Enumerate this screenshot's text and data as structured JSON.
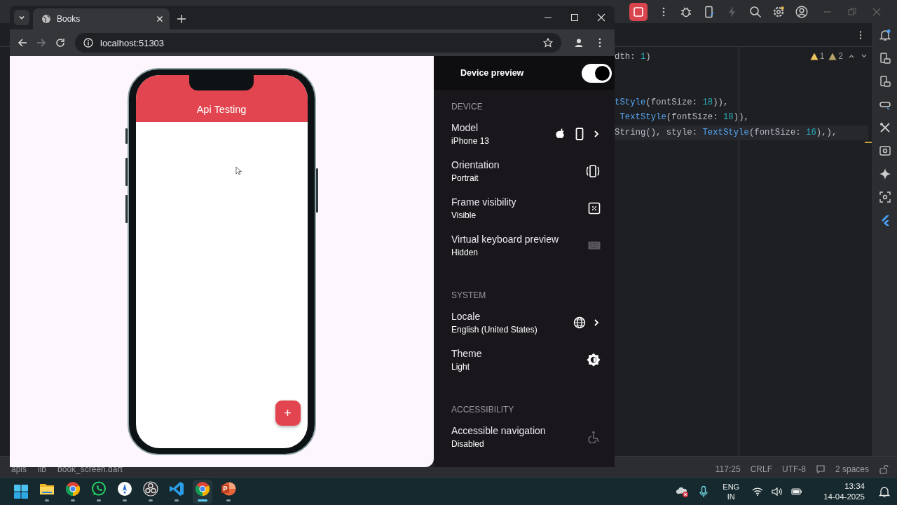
{
  "ide": {
    "inspections": [
      {
        "count": "1",
        "kind": "warning"
      },
      {
        "count": "2",
        "kind": "weak"
      }
    ],
    "code_lines": [
      {
        "current": false,
        "tokens": [
          {
            "text": "dth: ",
            "kind": "plain"
          },
          {
            "text": "1",
            "kind": "number"
          },
          {
            "text": ")",
            "kind": "plain"
          }
        ]
      },
      {
        "current": false,
        "tokens": [
          {
            "text": "tStyle",
            "kind": "class"
          },
          {
            "text": "(fontSize: ",
            "kind": "plain"
          },
          {
            "text": "18",
            "kind": "number"
          },
          {
            "text": ")),",
            "kind": "plain"
          }
        ]
      },
      {
        "current": false,
        "tokens": [
          {
            "text": " TextStyle",
            "kind": "class"
          },
          {
            "text": "(fontSize: ",
            "kind": "plain"
          },
          {
            "text": "18",
            "kind": "number"
          },
          {
            "text": ")),",
            "kind": "plain"
          }
        ]
      },
      {
        "current": true,
        "tokens": [
          {
            "text": "String(), style: ",
            "kind": "plain"
          },
          {
            "text": "TextStyle",
            "kind": "class"
          },
          {
            "text": "(fontSize: ",
            "kind": "plain"
          },
          {
            "text": "16",
            "kind": "number"
          },
          {
            "text": "),),",
            "kind": "plain"
          }
        ]
      }
    ],
    "breadcrumb": [
      "apis",
      "lib",
      "book_screen.dart"
    ],
    "status_bar": {
      "position": "117:25",
      "line_separator": "CRLF",
      "encoding": "UTF-8",
      "indent": "2 spaces"
    }
  },
  "browser": {
    "tabs": [
      {
        "title": "Books",
        "selected": true
      }
    ],
    "address": "localhost:51303",
    "forward_disabled": true
  },
  "app": {
    "title": "Api Testing",
    "fab": "+"
  },
  "device_preview": {
    "title": "Device preview",
    "on": true,
    "sections": [
      {
        "heading": "DEVICE",
        "rows": [
          {
            "kind": "model",
            "label": "Model",
            "value": "iPhone 13"
          },
          {
            "kind": "orientation",
            "label": "Orientation",
            "value": "Portrait"
          },
          {
            "kind": "frame",
            "label": "Frame visibility",
            "value": "Visible"
          },
          {
            "kind": "keyboard",
            "label": "Virtual keyboard preview",
            "value": "Hidden"
          }
        ]
      },
      {
        "heading": "SYSTEM",
        "rows": [
          {
            "kind": "locale",
            "label": "Locale",
            "value": "English (United States)"
          },
          {
            "kind": "theme",
            "label": "Theme",
            "value": "Light"
          }
        ]
      },
      {
        "heading": "ACCESSIBILITY",
        "rows": [
          {
            "kind": "accessibility",
            "label": "Accessible navigation",
            "value": "Disabled"
          }
        ]
      }
    ]
  },
  "taskbar": {
    "apps": [
      {
        "kind": "start",
        "running": false,
        "selected": false
      },
      {
        "kind": "files",
        "running": true,
        "selected": false
      },
      {
        "kind": "chrome",
        "running": true,
        "selected": false
      },
      {
        "kind": "whatsapp",
        "running": true,
        "selected": false
      },
      {
        "kind": "studio",
        "running": true,
        "selected": false
      },
      {
        "kind": "obs",
        "running": true,
        "selected": false
      },
      {
        "kind": "vscode",
        "running": true,
        "selected": false
      },
      {
        "kind": "chrome",
        "running": true,
        "selected": true
      },
      {
        "kind": "powerpoint",
        "running": true,
        "selected": false
      }
    ],
    "language": "ENG",
    "region": "IN",
    "time": "13:34",
    "date": "14-04-2025"
  }
}
